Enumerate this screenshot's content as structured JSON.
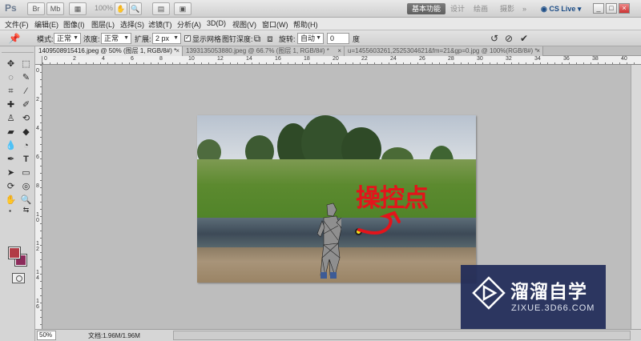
{
  "app": {
    "logo": "Ps",
    "zoom_display": "100%"
  },
  "workspaces": [
    "基本功能",
    "设计",
    "绘画",
    "摄影"
  ],
  "workspace_more": "»",
  "cslive": "CS Live",
  "window_controls": [
    "_",
    "□",
    "×"
  ],
  "menu": [
    "文件(F)",
    "编辑(E)",
    "图像(I)",
    "图层(L)",
    "选择(S)",
    "滤镜(T)",
    "分析(A)",
    "3D(D)",
    "视图(V)",
    "窗口(W)",
    "帮助(H)"
  ],
  "options": {
    "mode_label": "模式:",
    "mode_value": "正常",
    "density_label": "浓度:",
    "density_value": "正常",
    "expand_label": "扩展:",
    "expand_value": "2 px",
    "show_mesh_label": "显示网格",
    "pin_depth_label": "图钉深度:",
    "rotate_label": "旋转:",
    "rotate_value": "自动",
    "angle_value": "0",
    "angle_unit": "度"
  },
  "tabs": [
    {
      "label": "1409508915416.jpeg @ 50% (图层 1, RGB/8#) *",
      "active": true
    },
    {
      "label": "1393135053880.jpeg @ 66.7% (图层 1, RGB/8#) *",
      "active": false
    },
    {
      "label": "u=1455603261,2525304621&fm=21&gp=0.jpg @ 100%(RGB/8#) *",
      "active": false
    }
  ],
  "ruler_top_numbers": [
    "0",
    "2",
    "4",
    "6",
    "8",
    "10",
    "12",
    "14",
    "16",
    "18",
    "20",
    "22",
    "24",
    "26",
    "28",
    "30",
    "32",
    "34",
    "36",
    "38",
    "40"
  ],
  "ruler_left_numbers": [
    "0",
    "2",
    "4",
    "6",
    "8",
    "1\n0",
    "1\n2",
    "1\n4",
    "1\n6"
  ],
  "canvas_text": "操控点",
  "watermark": {
    "title": "溜溜自学",
    "url": "ZIXUE.3D66.COM"
  },
  "status": {
    "zoom": "50%",
    "doc_size": "文档:1.96M/1.96M"
  },
  "colors": {
    "foreground": "#b13c46",
    "background": "#8c2b5b",
    "overlay_text": "#e3141b",
    "watermark_bg": "#1f2a58"
  }
}
